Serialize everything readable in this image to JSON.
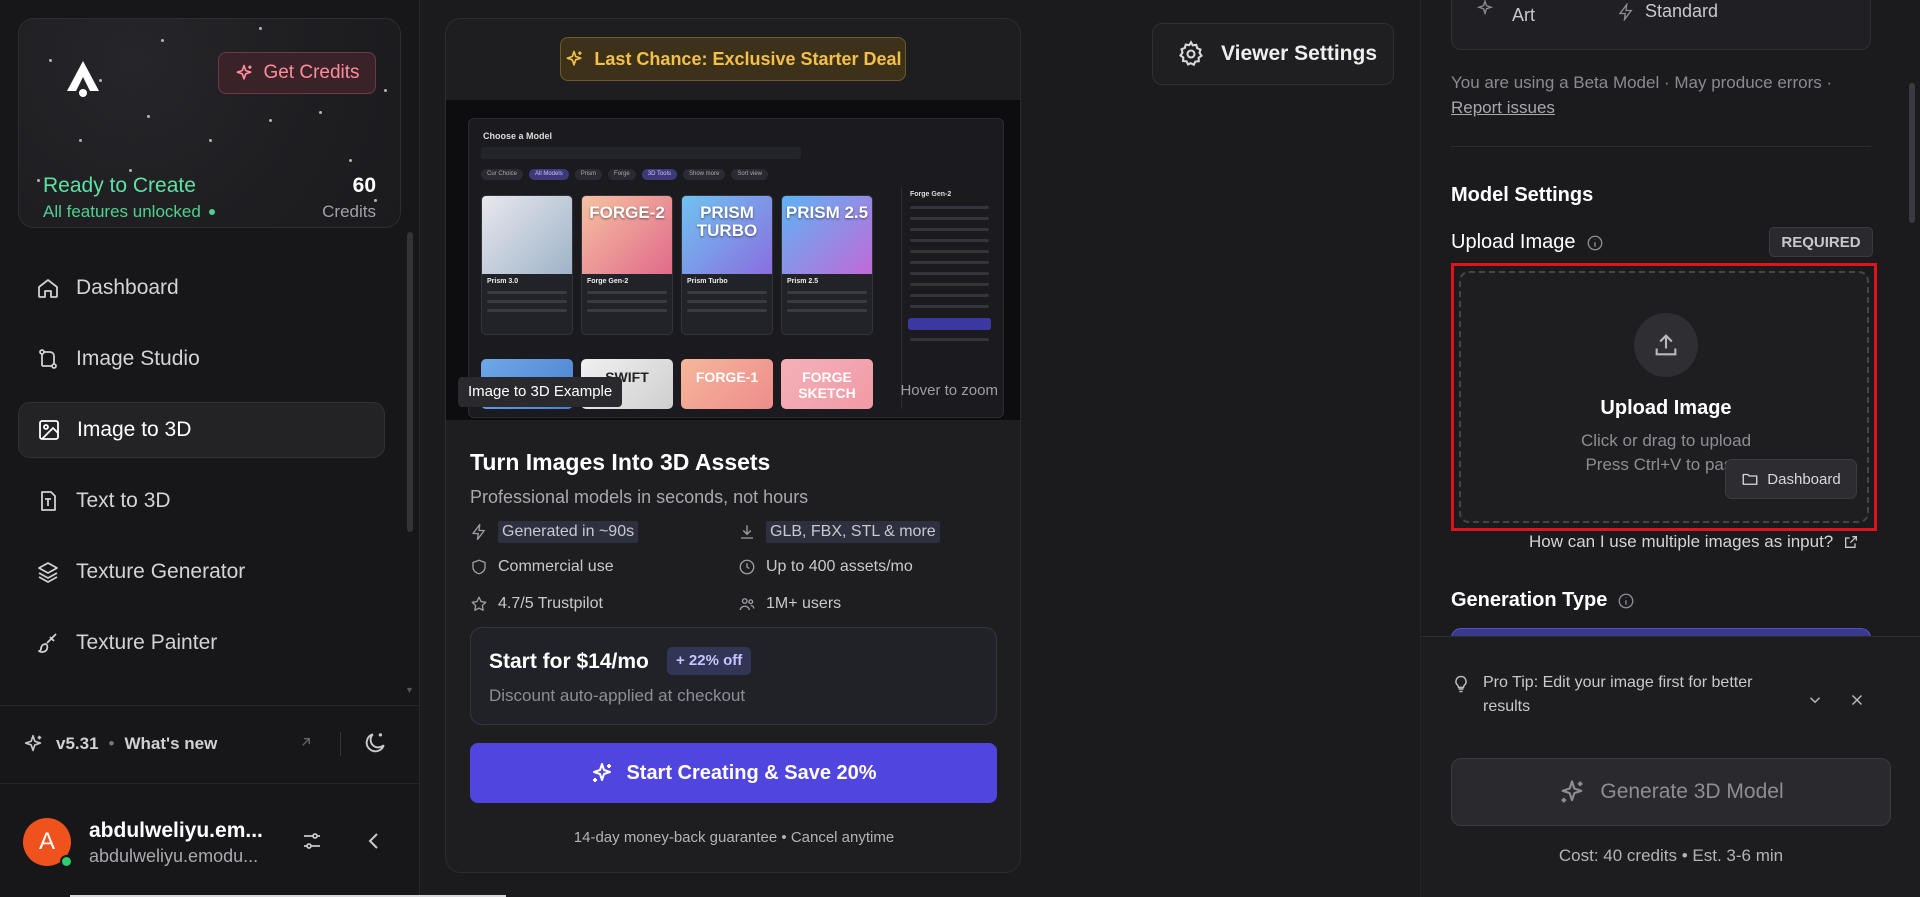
{
  "sidebar": {
    "get_credits_label": "Get Credits",
    "status_title": "Ready to Create",
    "status_sub": "All features unlocked",
    "credits_count": "60",
    "credits_label": "Credits",
    "items": [
      {
        "label": "Dashboard",
        "icon": "home-icon"
      },
      {
        "label": "Image Studio",
        "icon": "image-studio-icon"
      },
      {
        "label": "Image to 3D",
        "icon": "image-to-3d-icon",
        "active": true
      },
      {
        "label": "Text to 3D",
        "icon": "text-to-3d-icon"
      },
      {
        "label": "Texture Generator",
        "icon": "layers-icon"
      },
      {
        "label": "Texture Painter",
        "icon": "brush-icon"
      }
    ],
    "version": "v5.31",
    "separator": "•",
    "whats_new": "What's new",
    "user_name": "abdulweliyu.em...",
    "user_email": "abdulweliyu.emodu...",
    "avatar_letter": "A"
  },
  "promo": {
    "deal_label": "Last Chance: Exclusive Starter Deal",
    "preview": {
      "modal_title": "Choose a Model",
      "chips": [
        "Cur Choice",
        "All Models",
        "Prism",
        "Forge",
        "3D Tools",
        "Show more",
        "Sort view"
      ],
      "cards": [
        {
          "img_text": "",
          "name": "Prism 3.0"
        },
        {
          "img_text": "FORGE-2",
          "name": "Forge Gen-2"
        },
        {
          "img_text": "PRISM TURBO",
          "name": "Prism Turbo"
        },
        {
          "img_text": "PRISM 2.5",
          "name": "Prism 2.5"
        }
      ],
      "row2": [
        "",
        "SWIFT",
        "FORGE-1",
        "FORGE SKETCH"
      ],
      "side_title": "Forge Gen-2",
      "label": "Image to 3D Example",
      "hover": "Hover to zoom"
    },
    "title": "Turn Images Into 3D Assets",
    "subtitle": "Professional models in seconds, not hours",
    "features": [
      {
        "text": "Generated in ~90s",
        "icon": "bolt-icon",
        "highlight": true
      },
      {
        "text": "GLB, FBX, STL & more",
        "icon": "download-icon",
        "highlight": true
      },
      {
        "text": "Commercial use",
        "icon": "shield-icon"
      },
      {
        "text": "Up to 400 assets/mo",
        "icon": "clock-icon"
      },
      {
        "text": "4.7/5 Trustpilot",
        "icon": "star-icon"
      },
      {
        "text": "1M+ users",
        "icon": "users-icon"
      }
    ],
    "price": "Start for $14/mo",
    "discount": "+ 22% off",
    "price_note": "Discount auto-applied at checkout",
    "cta": "Start Creating & Save 20%",
    "guarantee": "14-day money-back guarantee • Cancel anytime"
  },
  "viewer_settings_label": "Viewer Settings",
  "right": {
    "seg_art": "Art",
    "seg_standard": "Standard",
    "beta_text": "You are using a Beta Model · May produce errors ·",
    "report_link": "Report issues",
    "model_settings": "Model Settings",
    "upload_label": "Upload Image",
    "required": "REQUIRED",
    "upload_title": "Upload Image",
    "upload_sub1": "Click or drag to upload",
    "upload_sub2": "Press Ctrl+V to paste",
    "dashboard_btn": "Dashboard",
    "multi_link": "How can I use multiple images as input?",
    "generation_type": "Generation Type",
    "tip": "Pro Tip: Edit your image first for better results",
    "generate": "Generate 3D Model",
    "cost": "Cost: 40 credits • Est. 3-6 min"
  },
  "colors": {
    "accent": "#5145e0",
    "highlight_red": "#e0131c",
    "status_green": "#5fe0a4",
    "deal_gold": "#f2c04b",
    "credits_pink": "#ff8b9c"
  }
}
